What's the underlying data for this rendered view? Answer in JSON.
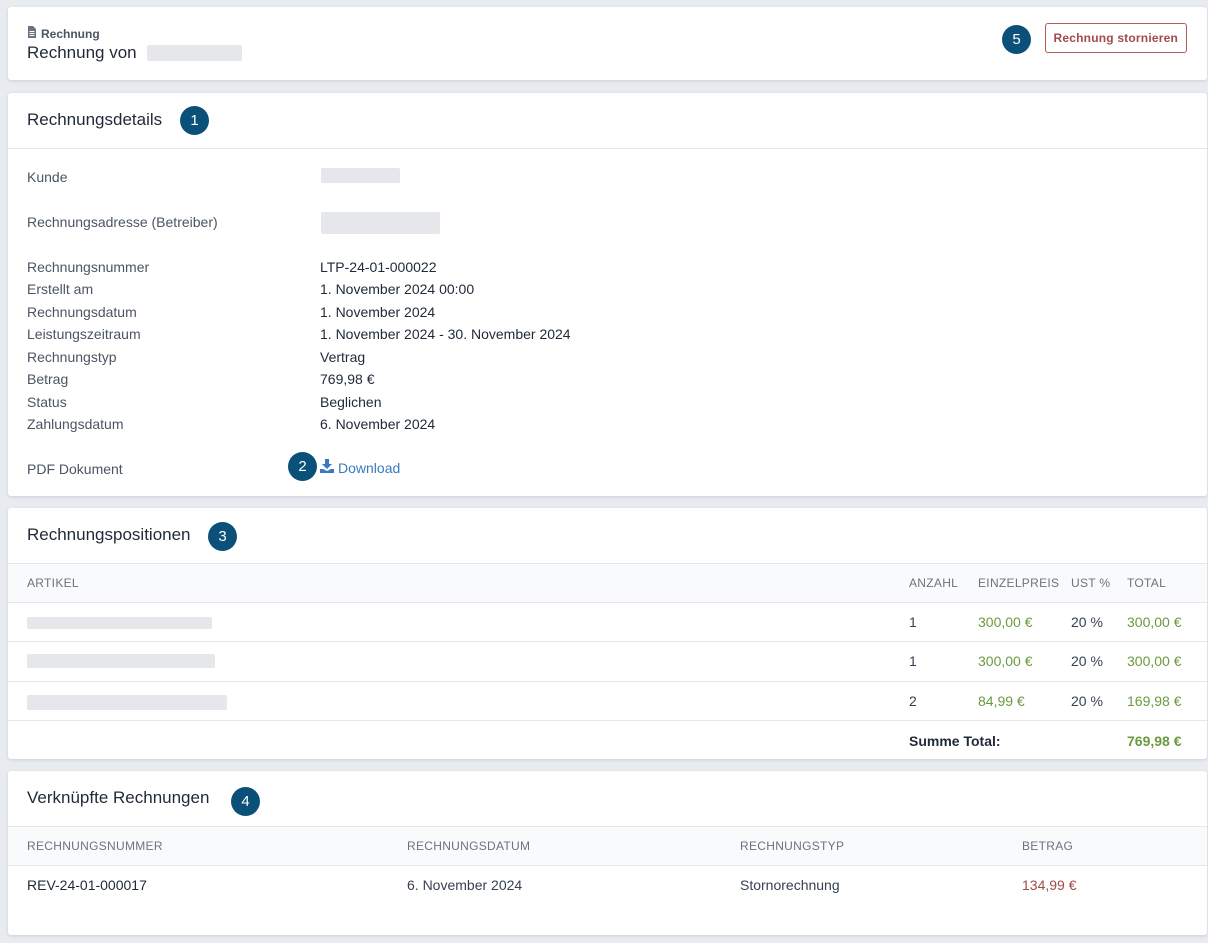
{
  "header": {
    "crumb": "Rechnung",
    "title": "Rechnung von",
    "cancel_label": "Rechnung stornieren",
    "badge": "5"
  },
  "details": {
    "title": "Rechnungsdetails",
    "badge": "1",
    "rows": [
      {
        "label": "Kunde",
        "value": ""
      },
      {
        "label": "Rechnungsadresse (Betreiber)",
        "value": ""
      },
      {
        "label": "Rechnungsnummer",
        "value": "LTP-24-01-000022"
      },
      {
        "label": "Erstellt am",
        "value": "1. November 2024 00:00"
      },
      {
        "label": "Rechnungsdatum",
        "value": "1. November 2024"
      },
      {
        "label": "Leistungszeitraum",
        "value": "1. November 2024 - 30. November 2024"
      },
      {
        "label": "Rechnungstyp",
        "value": "Vertrag"
      },
      {
        "label": "Betrag",
        "value": "769,98 €"
      },
      {
        "label": "Status",
        "value": "Beglichen"
      },
      {
        "label": "Zahlungsdatum",
        "value": "6. November 2024"
      },
      {
        "label": "PDF Dokument",
        "value": "Download"
      }
    ],
    "download_badge": "2"
  },
  "positions": {
    "title": "Rechnungspositionen",
    "badge": "3",
    "columns": [
      "Artikel",
      "Anzahl",
      "Einzelpreis",
      "Ust %",
      "Total"
    ],
    "rows": [
      {
        "artikel": "",
        "anzahl": "1",
        "einzelpreis": "300,00 €",
        "ust": "20 %",
        "total": "300,00 €"
      },
      {
        "artikel": "",
        "anzahl": "1",
        "einzelpreis": "300,00 €",
        "ust": "20 %",
        "total": "300,00 €"
      },
      {
        "artikel": "",
        "anzahl": "2",
        "einzelpreis": "84,99 €",
        "ust": "20 %",
        "total": "169,98 €"
      }
    ],
    "sum_label": "Summe Total:",
    "sum_value": "769,98 €"
  },
  "linked": {
    "title": "Verknüpfte Rechnungen",
    "badge": "4",
    "columns": [
      "Rechnungsnummer",
      "Rechnungsdatum",
      "Rechnungstyp",
      "Betrag"
    ],
    "rows": [
      {
        "nummer": "REV-24-01-000017",
        "datum": "6. November 2024",
        "typ": "Stornorechnung",
        "betrag": "134,99 €"
      }
    ]
  },
  "colors": {
    "badge": "#0b5078",
    "link": "#3a7bbf",
    "positive_amount": "#6a9a3e",
    "negative_amount": "#a14b4b"
  }
}
